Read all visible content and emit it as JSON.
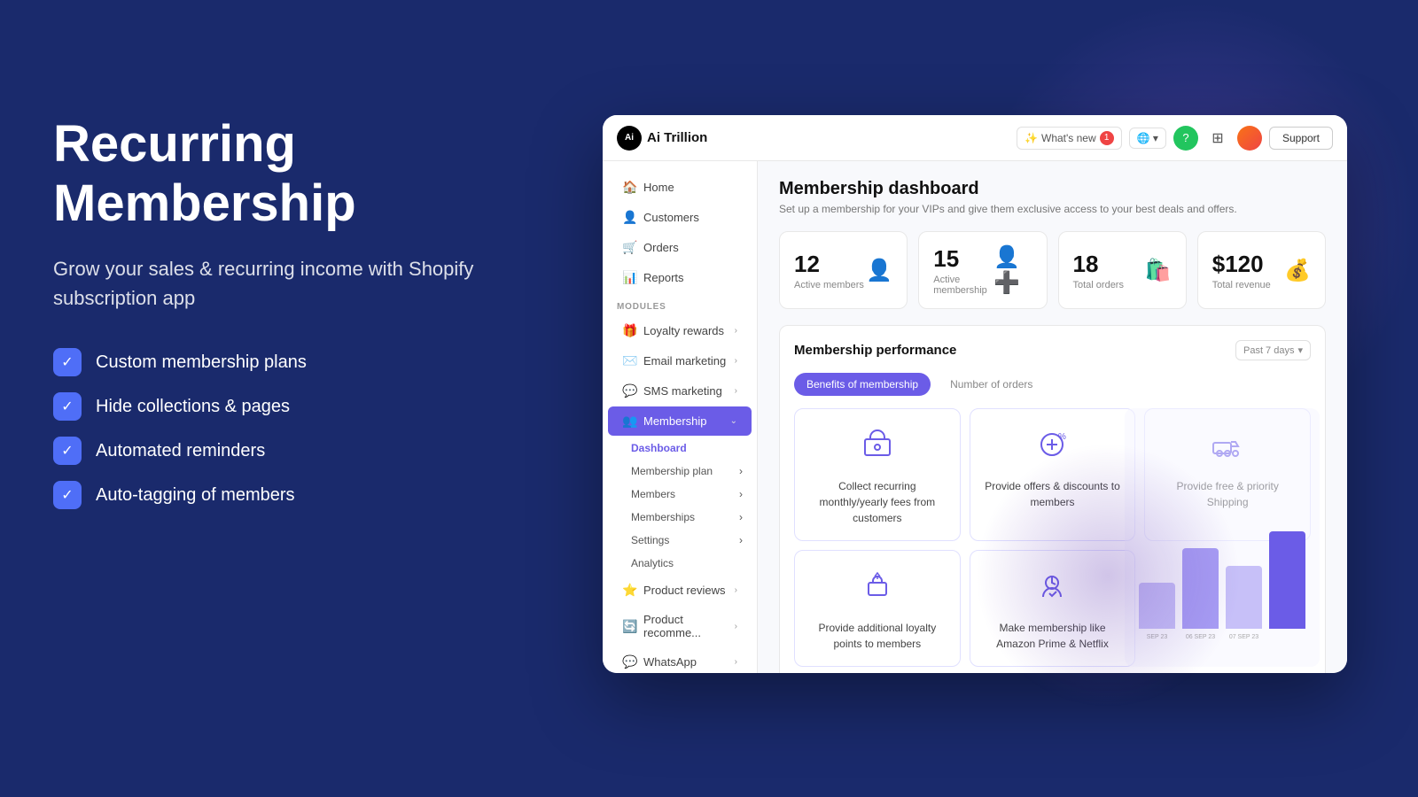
{
  "left": {
    "title_line1": "Recurring",
    "title_line2": "Membership",
    "subtitle": "Grow your sales & recurring income with Shopify subscription app",
    "features": [
      "Custom membership plans",
      "Hide collections & pages",
      "Automated reminders",
      "Auto-tagging of members"
    ]
  },
  "topbar": {
    "logo_text": "Ai Trillion",
    "whats_new": "What's new",
    "notification_count": "1",
    "support_label": "Support"
  },
  "sidebar": {
    "nav_items": [
      {
        "label": "Home",
        "icon": "🏠"
      },
      {
        "label": "Customers",
        "icon": "👤"
      },
      {
        "label": "Orders",
        "icon": "🛒"
      },
      {
        "label": "Reports",
        "icon": "📊"
      }
    ],
    "modules_label": "MODULES",
    "modules": [
      {
        "label": "Loyalty rewards",
        "icon": "🎁",
        "has_arrow": true
      },
      {
        "label": "Email marketing",
        "icon": "✉️",
        "has_arrow": true
      },
      {
        "label": "SMS marketing",
        "icon": "💬",
        "has_arrow": true
      },
      {
        "label": "Membership",
        "icon": "👥",
        "active": true,
        "has_arrow": true
      }
    ],
    "membership_sub": [
      {
        "label": "Dashboard",
        "active": true
      },
      {
        "label": "Membership plan",
        "has_arrow": true
      },
      {
        "label": "Members",
        "has_arrow": true
      },
      {
        "label": "Memberships",
        "has_arrow": true
      },
      {
        "label": "Settings",
        "has_arrow": true
      },
      {
        "label": "Analytics"
      }
    ],
    "bottom_modules": [
      {
        "label": "Product reviews",
        "icon": "⭐",
        "has_arrow": true
      },
      {
        "label": "Product recomme...",
        "icon": "🔄",
        "has_arrow": true
      },
      {
        "label": "WhatsApp",
        "icon": "💬",
        "has_arrow": true
      }
    ]
  },
  "content": {
    "page_title": "Membership dashboard",
    "page_subtitle": "Set up a membership for your VIPs and give them exclusive access to your best deals and offers.",
    "stats": [
      {
        "number": "12",
        "label": "Active members",
        "icon": "👤"
      },
      {
        "number": "15",
        "label": "Active membership",
        "icon": "👤"
      },
      {
        "number": "18",
        "label": "Total orders",
        "icon": "🛍️"
      },
      {
        "number": "$120",
        "label": "Total revenue",
        "icon": "💰"
      }
    ],
    "performance_title": "Membership performance",
    "period": "Past 7 days",
    "tabs": [
      {
        "label": "Benefits of membership",
        "active": true
      },
      {
        "label": "Number of orders",
        "active": false
      }
    ],
    "benefits": [
      {
        "icon": "💵",
        "text": "Collect recurring monthly/yearly fees from customers"
      },
      {
        "icon": "🏷️",
        "text": "Provide offers & discounts to members"
      },
      {
        "icon": "🚚",
        "text": "Provide free & priority Shipping"
      },
      {
        "icon": "🎁",
        "text": "Provide additional loyalty points to members"
      },
      {
        "icon": "🏆",
        "text": "Make membership like Amazon Prime & Netflix"
      }
    ],
    "chart_labels": [
      "SEP 23",
      "06 SEP 23",
      "07 SEP 23"
    ]
  }
}
